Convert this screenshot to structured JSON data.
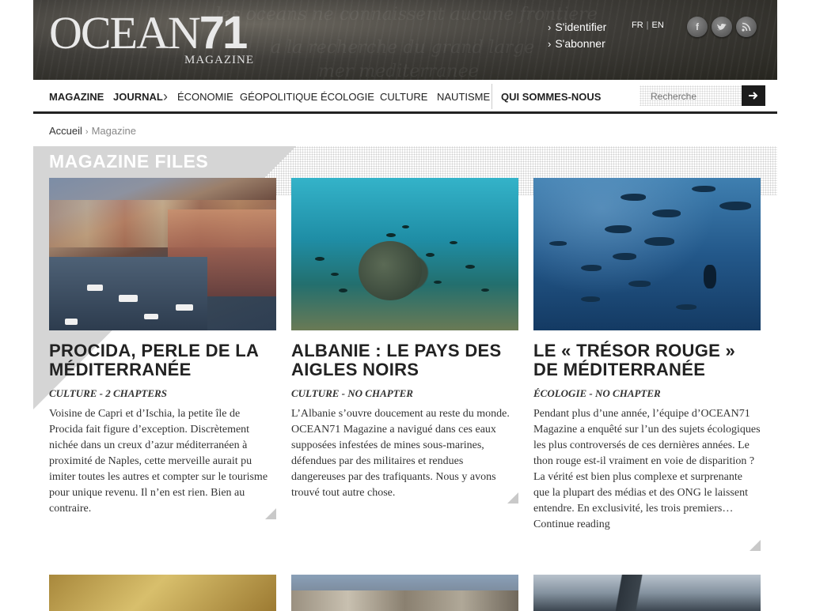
{
  "header": {
    "logo_text": "OCEAN",
    "logo_number": "71",
    "logo_sub": "MAGAZINE",
    "account_links": [
      "S'identifier",
      "S'abonner"
    ],
    "languages": [
      "FR",
      "EN"
    ],
    "social_icons": [
      "facebook-icon",
      "twitter-icon",
      "rss-icon"
    ]
  },
  "nav": {
    "items": [
      "MAGAZINE",
      "JOURNAL",
      "ÉCONOMIE",
      "GÉOPOLITIQUE",
      "ÉCOLOGIE",
      "CULTURE",
      "NAUTISME",
      "QUI SOMMES-NOUS"
    ],
    "search_placeholder": "Recherche",
    "search_button_icon": "arrow-right-icon"
  },
  "breadcrumb": {
    "home": "Accueil",
    "current": "Magazine"
  },
  "section": {
    "title": "MAGAZINE FILES"
  },
  "cards": [
    {
      "title": "PROCIDA, PERLE DE LA MÉDITERRANÉE",
      "meta": "CULTURE - 2 CHAPTERS",
      "excerpt": "Voisine de Capri et d’Ischia, la petite île de Procida fait figure d’exception. Discrètement nichée dans un creux d’azur méditerranéen à proximité de Naples, cette merveille aurait pu imiter toutes les autres et compter sur le tourisme pour unique revenu. Il n’en est rien. Bien au contraire."
    },
    {
      "title": "ALBANIE : LE PAYS DES AIGLES NOIRS",
      "meta": "CULTURE - NO CHAPTER",
      "excerpt": "L’Albanie s’ouvre doucement au reste du monde. OCEAN71 Magazine a navigué dans ces eaux supposées infestées de mines sous-marines, défendues par des militaires et rendues dangereuses par des trafiquants. Nous y avons trouvé tout autre chose."
    },
    {
      "title": "LE « TRÉSOR ROUGE » DE MÉDITERRANÉE",
      "meta": "ÉCOLOGIE - NO CHAPTER",
      "excerpt": "Pendant plus d’une année, l’équipe d’OCEAN71 Magazine a enquêté sur l’un des sujets écologiques les plus controversés de ces dernières années. Le thon rouge est-il vraiment en voie de disparition ? La vérité est bien plus complexe et surprenante que la plupart des médias et des ONG le laissent entendre. En exclusivité, les trois premiers…",
      "read_more": "Continue reading"
    }
  ]
}
